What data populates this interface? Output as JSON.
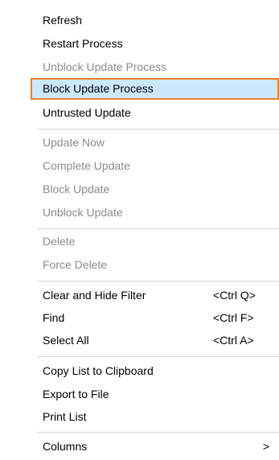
{
  "menu": {
    "groups": [
      [
        "Refresh",
        "Restart Process",
        "Unblock Update Process",
        "Block Update Process",
        "Untrusted Update"
      ],
      [
        "Update Now",
        "Complete Update",
        "Block Update",
        "Unblock Update"
      ],
      [
        "Delete",
        "Force Delete"
      ],
      [
        "Clear and Hide Filter",
        "Find",
        "Select All"
      ],
      [
        "Copy List to Clipboard",
        "Export to File",
        "Print List"
      ],
      [
        "Columns"
      ]
    ],
    "items": {
      "refresh": "Refresh",
      "restart_process": "Restart Process",
      "unblock_update_process": "Unblock Update Process",
      "block_update_process": "Block Update Process",
      "untrusted_update": "Untrusted Update",
      "update_now": "Update Now",
      "complete_update": "Complete Update",
      "block_update": "Block Update",
      "unblock_update": "Unblock Update",
      "delete": "Delete",
      "force_delete": "Force Delete",
      "clear_and_hide_filter": "Clear and Hide Filter",
      "find": "Find",
      "select_all": "Select All",
      "copy_list_to_clipboard": "Copy List to Clipboard",
      "export_to_file": "Export to File",
      "print_list": "Print List",
      "columns": "Columns"
    },
    "shortcuts": {
      "clear_and_hide_filter": "<Ctrl Q>",
      "find": "<Ctrl F>",
      "select_all": "<Ctrl A>"
    },
    "submenu_arrow": ">",
    "highlighted_item": "Block Update Process",
    "colors": {
      "highlight_bg": "#cce8ff",
      "highlight_border": "#e8812a",
      "disabled_text": "#8a8a8a",
      "separator": "#d7d7d7"
    }
  }
}
